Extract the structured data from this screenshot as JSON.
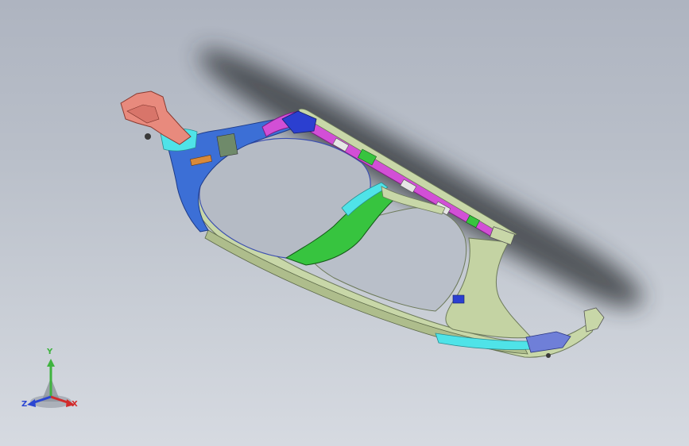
{
  "viewport": {
    "background_top": "#aeb4c0",
    "background_bottom": "#d6dae1"
  },
  "model": {
    "part_colors": {
      "frame": "#c8d7a8",
      "top_rail": "#d24fd6",
      "upper_left_mount": "#e88a7d",
      "left_bracket": "#3c6fd6",
      "cyan_parts": "#4fe3e8",
      "center_brace": "#37c43f",
      "lower_right_mount": "#6f7fd8"
    }
  },
  "triad": {
    "y_label": "Y",
    "x_label": "X",
    "z_label": "Z",
    "y_color": "#3fb33f",
    "x_color": "#d22b2b",
    "z_color": "#2b46d2"
  }
}
